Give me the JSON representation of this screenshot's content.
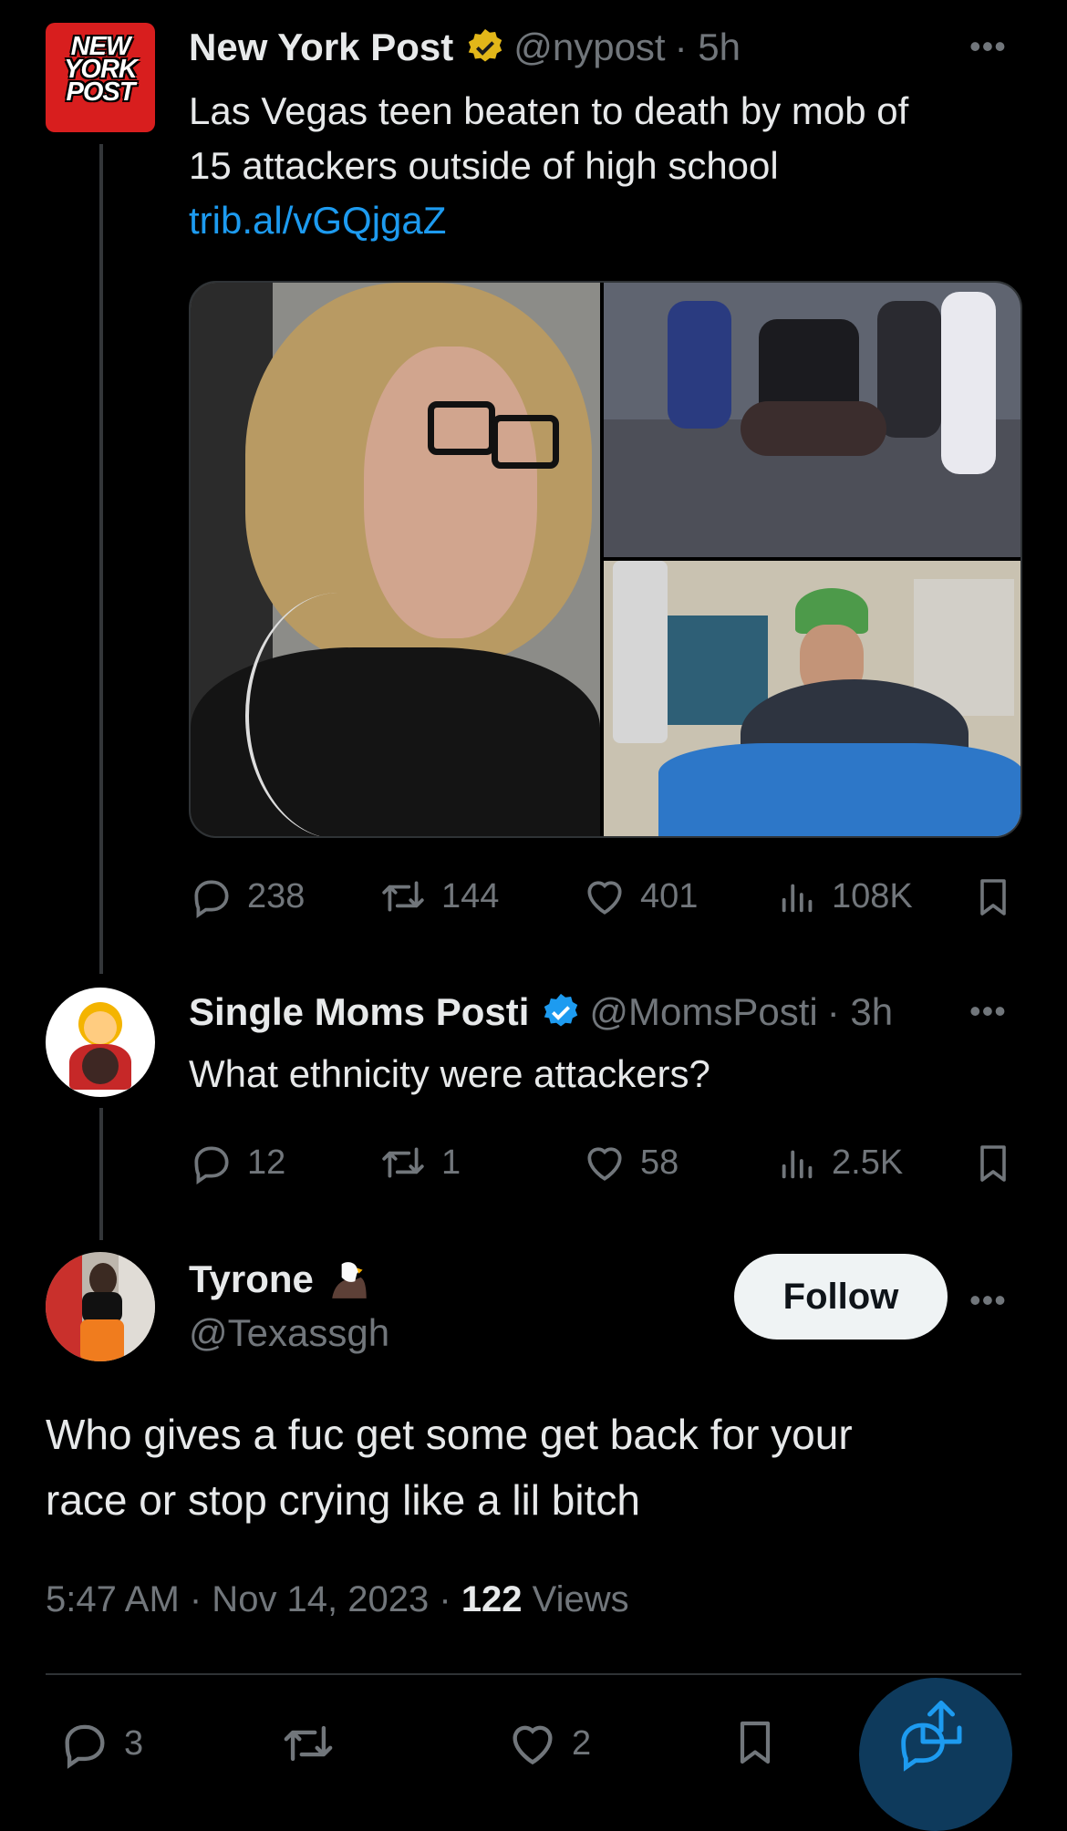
{
  "tweet1": {
    "author_name": "New York Post",
    "handle": "@nypost",
    "time": "· 5h",
    "logo_text": "NEW YORK POST",
    "text_line1": "Las Vegas teen beaten to death by mob of",
    "text_line2": "15 attackers outside of high school",
    "link": "trib.al/vGQjgaZ",
    "badge": "gold-verified",
    "stats": {
      "replies": "238",
      "reposts": "144",
      "likes": "401",
      "views": "108K"
    }
  },
  "tweet2": {
    "author_name": "Single Moms Posti",
    "handle": "@MomsPosti",
    "time": "· 3h",
    "text": "What ethnicity were attackers?",
    "badge": "blue-verified",
    "stats": {
      "replies": "12",
      "reposts": "1",
      "likes": "58",
      "views": "2.5K"
    }
  },
  "tweet3": {
    "author_name": "Tyrone",
    "handle": "@Texassgh",
    "follow_label": "Follow",
    "text_line1": "Who gives a fuc get some get back for your",
    "text_line2": "race or stop crying like a lil bitch",
    "time": "5:47 AM · Nov 14, 2023 · ",
    "views_count": "122",
    "views_label": " Views",
    "stats": {
      "replies": "3",
      "likes": "2"
    }
  },
  "icons": {
    "reply": "reply-icon",
    "repost": "repost-icon",
    "like": "heart-icon",
    "views": "views-icon",
    "bookmark": "bookmark-icon",
    "share": "share-icon",
    "more": "more-icon",
    "eagle": "eagle-emoji-icon"
  },
  "colors": {
    "accent": "#1d9bf0",
    "gold": "#e2b719",
    "muted": "#71767b",
    "brand_red": "#d81e1e"
  }
}
